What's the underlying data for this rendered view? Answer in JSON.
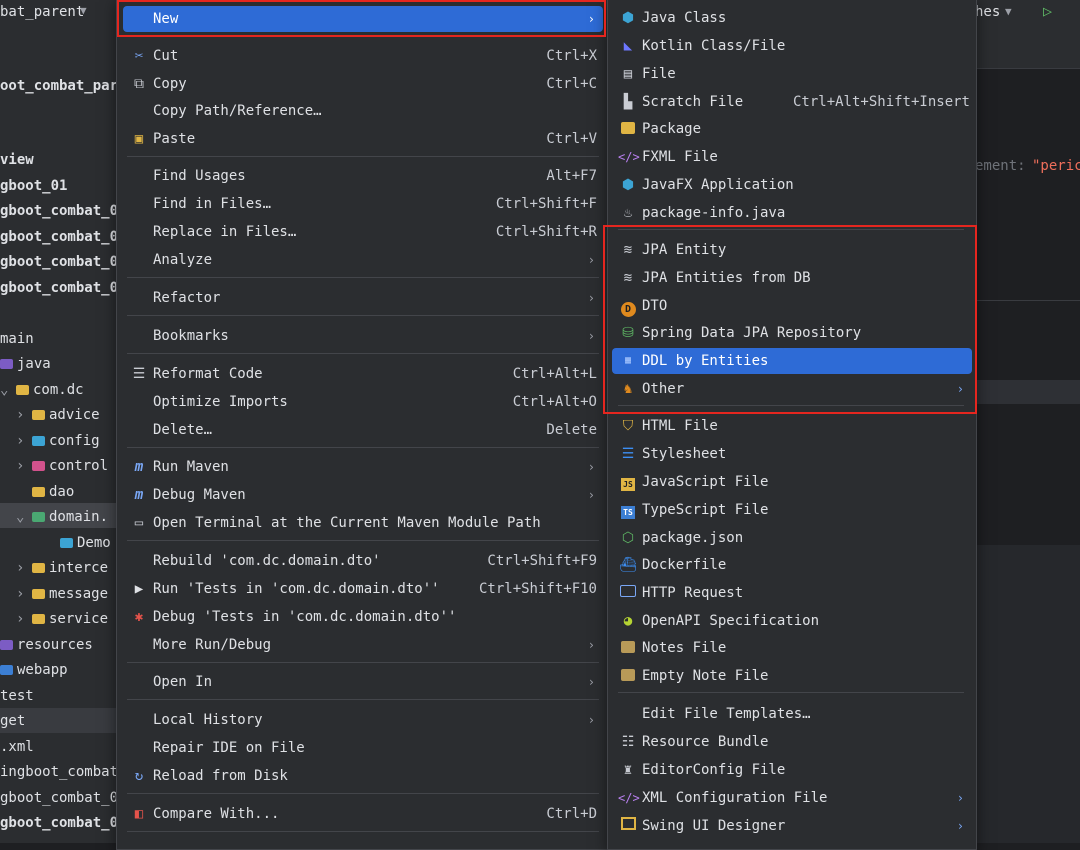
{
  "ide": {
    "project_selector": "bat_parent",
    "branch_label": "hes",
    "editor_hint": "ement:",
    "editor_string": "\"peric"
  },
  "tree": [
    {
      "text": "oot_combat_pare",
      "bold": true
    },
    {
      "text": "view",
      "bold": true
    },
    {
      "text": "gboot_01",
      "bold": true
    },
    {
      "text": "gboot_combat_0",
      "bold": true
    },
    {
      "text": "gboot_combat_0",
      "bold": true
    },
    {
      "text": "gboot_combat_0",
      "bold": true
    },
    {
      "text": "gboot_combat_0",
      "bold": true
    },
    {
      "text": "main",
      "bold": false
    },
    {
      "text": "java",
      "bold": false
    },
    {
      "text": "com.dc",
      "bold": false
    },
    {
      "text": "advice",
      "bold": false
    },
    {
      "text": "config",
      "bold": false
    },
    {
      "text": "control",
      "bold": false
    },
    {
      "text": "dao",
      "bold": false
    },
    {
      "text": "domain.",
      "bold": false
    },
    {
      "text": "Demo",
      "bold": false
    },
    {
      "text": "interce",
      "bold": false
    },
    {
      "text": "message",
      "bold": false
    },
    {
      "text": "service",
      "bold": false
    },
    {
      "text": "resources",
      "bold": false
    },
    {
      "text": "webapp",
      "bold": false
    },
    {
      "text": "test",
      "bold": false
    },
    {
      "text": "get",
      "bold": false
    },
    {
      "text": ".xml",
      "bold": false
    },
    {
      "text": "ingboot_combat",
      "bold": false
    },
    {
      "text": "gboot_combat_0",
      "bold": false
    },
    {
      "text": "gboot_combat_0",
      "bold": true
    }
  ],
  "main_menu": {
    "new": "New",
    "cut": "Cut",
    "cut_sc": "Ctrl+X",
    "copy": "Copy",
    "copy_sc": "Ctrl+C",
    "copy_path": "Copy Path/Reference…",
    "paste": "Paste",
    "paste_sc": "Ctrl+V",
    "find_usages": "Find Usages",
    "find_usages_sc": "Alt+F7",
    "find_in_files": "Find in Files…",
    "find_in_files_sc": "Ctrl+Shift+F",
    "replace_in_files": "Replace in Files…",
    "replace_in_files_sc": "Ctrl+Shift+R",
    "analyze": "Analyze",
    "refactor": "Refactor",
    "bookmarks": "Bookmarks",
    "reformat": "Reformat Code",
    "reformat_sc": "Ctrl+Alt+L",
    "optimize": "Optimize Imports",
    "optimize_sc": "Ctrl+Alt+O",
    "delete": "Delete…",
    "delete_sc": "Delete",
    "run_maven": "Run Maven",
    "debug_maven": "Debug Maven",
    "open_terminal": "Open Terminal at the Current Maven Module Path",
    "rebuild": "Rebuild 'com.dc.domain.dto'",
    "rebuild_sc": "Ctrl+Shift+F9",
    "run_tests": "Run 'Tests in 'com.dc.domain.dto''",
    "run_tests_sc": "Ctrl+Shift+F10",
    "debug_tests": "Debug 'Tests in 'com.dc.domain.dto''",
    "more_run": "More Run/Debug",
    "open_in": "Open In",
    "local_history": "Local History",
    "repair_ide": "Repair IDE on File",
    "reload": "Reload from Disk",
    "compare": "Compare With...",
    "compare_sc": "Ctrl+D"
  },
  "sub_menu": {
    "java_class": "Java Class",
    "kotlin": "Kotlin Class/File",
    "file": "File",
    "scratch": "Scratch File",
    "scratch_sc": "Ctrl+Alt+Shift+Insert",
    "package": "Package",
    "fxml": "FXML File",
    "javafx": "JavaFX Application",
    "package_info": "package-info.java",
    "jpa_entity": "JPA Entity",
    "jpa_entities_db": "JPA Entities from DB",
    "dto": "DTO",
    "spring_repo": "Spring Data JPA Repository",
    "ddl": "DDL by Entities",
    "other": "Other",
    "html": "HTML File",
    "stylesheet": "Stylesheet",
    "js": "JavaScript File",
    "ts": "TypeScript File",
    "package_json": "package.json",
    "dockerfile": "Dockerfile",
    "http": "HTTP Request",
    "openapi": "OpenAPI Specification",
    "notes": "Notes File",
    "empty_note": "Empty Note File",
    "edit_templates": "Edit File Templates…",
    "resource_bundle": "Resource Bundle",
    "editorconfig": "EditorConfig File",
    "xml_config": "XML Configuration File",
    "swing": "Swing UI Designer"
  },
  "colors": {
    "selection": "#2e6bd6",
    "highlight_box": "#e5261f",
    "menu_bg": "#2b2d30"
  }
}
